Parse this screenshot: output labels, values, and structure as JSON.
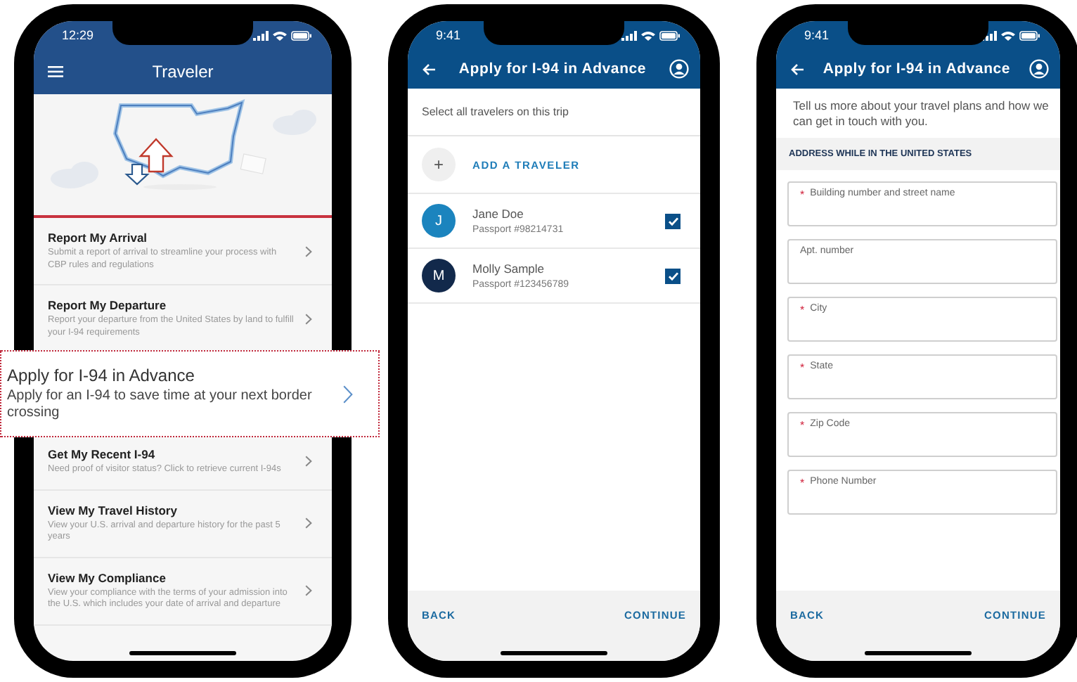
{
  "home_screen": {
    "time": "12:29",
    "title": "Traveler",
    "items": [
      {
        "title": "Report My Arrival",
        "description": "Submit a report of arrival to streamline your process with CBP rules and regulations"
      },
      {
        "title": "Report My Departure",
        "description": "Report your departure from the United States by land to fulfill your I-94 requirements"
      },
      {
        "title": "Get My Recent I-94",
        "description": "Need proof of visitor status? Click to retrieve current I-94s"
      },
      {
        "title": "View My Travel History",
        "description": "View your U.S. arrival and departure history for the past 5 years"
      },
      {
        "title": "View My Compliance",
        "description": "View your compliance with the terms of your admission into the U.S. which includes your date of arrival and departure"
      }
    ]
  },
  "callout": {
    "title": "Apply for I-94 in Advance",
    "description": "Apply for an I-94 to save time at your next border crossing"
  },
  "travelers_screen": {
    "time": "9:41",
    "title": "Apply for I-94 in Advance",
    "intro": "Select all travelers on this trip",
    "add_button": "ADD A TRAVELER",
    "add_icon": "+",
    "travelers": [
      {
        "initial": "J",
        "name": "Jane Doe",
        "passport": "Passport #98214731",
        "color": "#1b84be",
        "checked": true
      },
      {
        "initial": "M",
        "name": "Molly Sample",
        "passport": "Passport #123456789",
        "color": "#12294b",
        "checked": true
      }
    ],
    "back": "BACK",
    "continue": "CONTINUE"
  },
  "address_screen": {
    "time": "9:41",
    "title": "Apply for I-94 in Advance",
    "intro": "Tell us more about your travel plans and how we can get in touch with you.",
    "section": "ADDRESS WHILE IN THE UNITED STATES",
    "fields": [
      {
        "placeholder": "Building number and street name",
        "required": true
      },
      {
        "placeholder": "Apt. number",
        "required": false
      },
      {
        "placeholder": "City",
        "required": true
      },
      {
        "placeholder": "State",
        "required": true
      },
      {
        "placeholder": "Zip Code",
        "required": true
      },
      {
        "placeholder": "Phone Number",
        "required": true
      }
    ],
    "required_mark": "*",
    "back": "BACK",
    "continue": "CONTINUE"
  }
}
